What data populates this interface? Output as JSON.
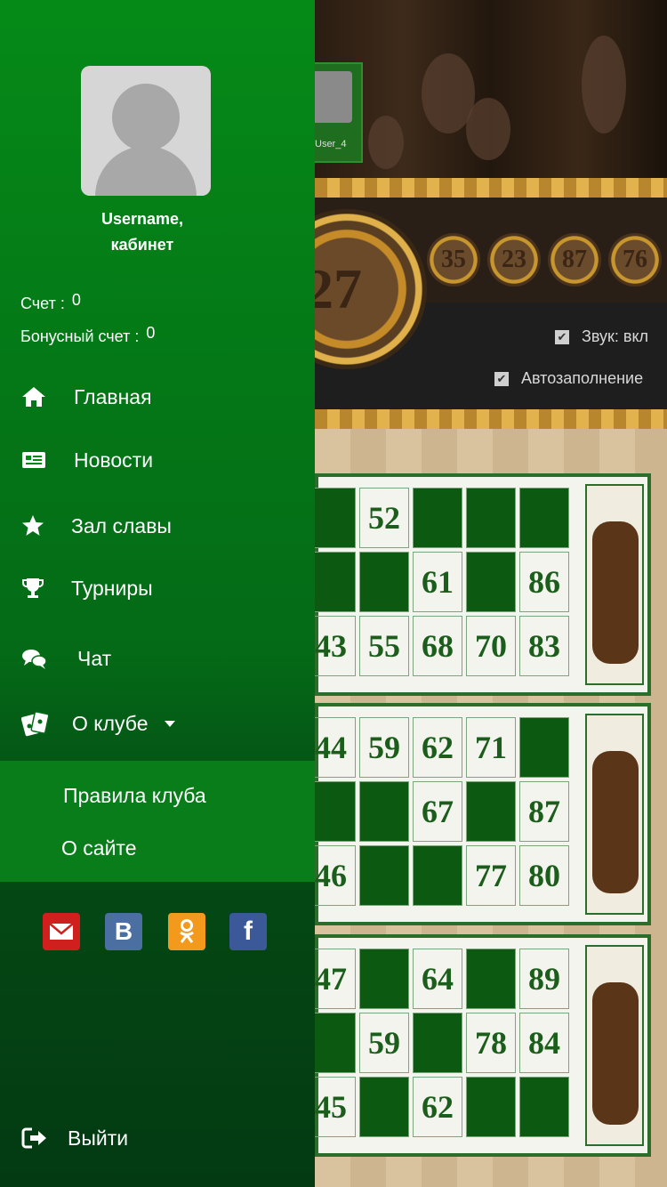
{
  "profile": {
    "username": "Username,",
    "cabinet": "кабинет",
    "score_label": "Счет :",
    "score_value": "0",
    "bonus_label": "Бонусный счет :",
    "bonus_value": "0"
  },
  "menu": {
    "home": "Главная",
    "news": "Новости",
    "hall_of_fame": "Зал славы",
    "tournaments": "Турниры",
    "chat": "Чат",
    "about_club": "О клубе"
  },
  "submenu": {
    "rules": "Правила клуба",
    "about_site": "О сайте"
  },
  "social": [
    "email-icon",
    "vk-icon",
    "ok-icon",
    "facebook-icon"
  ],
  "logout": "Выйти",
  "game": {
    "player_name": "User_4",
    "current_ball": "27",
    "previous_balls": [
      "35",
      "23",
      "87",
      "76"
    ],
    "sound_label": "Звук: вкл",
    "autofill_label": "Автозаполнение",
    "cards": [
      [
        [
          "",
          "52",
          "",
          "",
          ""
        ],
        [
          "",
          "",
          "61",
          "",
          "86"
        ],
        [
          "43",
          "55",
          "68",
          "70",
          "83"
        ]
      ],
      [
        [
          "44",
          "59",
          "62",
          "71",
          ""
        ],
        [
          "",
          "",
          "67",
          "",
          "87"
        ],
        [
          "46",
          "",
          "",
          "77",
          "80"
        ]
      ],
      [
        [
          "47",
          "",
          "64",
          "",
          "89"
        ],
        [
          "",
          "59",
          "",
          "78",
          "84"
        ],
        [
          "45",
          "",
          "62",
          "",
          ""
        ]
      ]
    ]
  },
  "colors": {
    "drawer_top": "#058a17",
    "drawer_bottom": "#033a12",
    "submenu_bg": "#087d1a",
    "card_number": "#1b5e1b",
    "email": "#d0201e",
    "vk": "#4a6fa0",
    "ok": "#f39a1d",
    "facebook": "#3b5998"
  }
}
